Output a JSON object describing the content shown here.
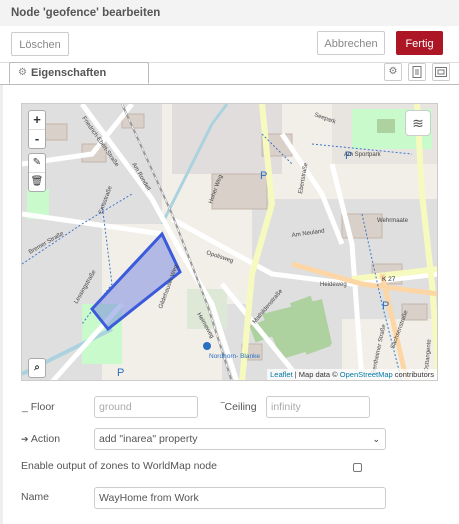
{
  "tray": {
    "title": "Node 'geofence' bearbeiten"
  },
  "toolbar": {
    "delete_label": "Löschen",
    "cancel_label": "Abbrechen",
    "done_label": "Fertig"
  },
  "tabs": {
    "properties_label": "Eigenschaften"
  },
  "map": {
    "labels": {
      "seepark": "Seepark",
      "am_sportpark": "Am Sportpark",
      "wehrmaate": "Wehrmaate",
      "k27": "K 27",
      "heideweg": "Heideweg",
      "am_neuland": "Am Neuland",
      "opolisweg": "Opolisweg",
      "mathildenstrasse": "Mathildenstraße",
      "nordhorn_blanke": "Nordhorn-\nBlanke",
      "sachsenstrasse": "Sachsenstraße",
      "osttangente": "Osttangente",
      "bentheimer_strasse": "Bentheimer Straße",
      "friedrich_ebert_strasse": "Friedrich-Ebert-Straße",
      "gildehauser_weg": "Gildehauser Weg",
      "heimeweg": "Heimeweg",
      "bremer_strasse": "Bremer Straße",
      "ebertstrasse": "Ebertstraße",
      "emsstrasse": "Emsstraße",
      "am_rondell": "Am Rondell",
      "lessingstrasse": "Lessingstraße",
      "hoher_weg": "Hoher Weg"
    },
    "attribution_leaflet": "Leaflet",
    "attribution_text": " | Map data © ",
    "attribution_osm": "OpenStreetMap",
    "attribution_contrib": " contributors"
  },
  "form": {
    "floor_label": "_ Floor",
    "floor_placeholder": "ground",
    "ceiling_label": "‾Ceiling",
    "ceiling_placeholder": "infinity",
    "action_label": "Action",
    "action_value": "add \"inarea\" property",
    "worldmap_label": "Enable output of zones to WorldMap node",
    "worldmap_checked": false,
    "name_label": "Name",
    "name_value": "WayHome from Work"
  },
  "colors": {
    "done_button": "#ad1625",
    "polygon_stroke": "#3b5bdb",
    "polygon_fill": "#7b8de0"
  }
}
